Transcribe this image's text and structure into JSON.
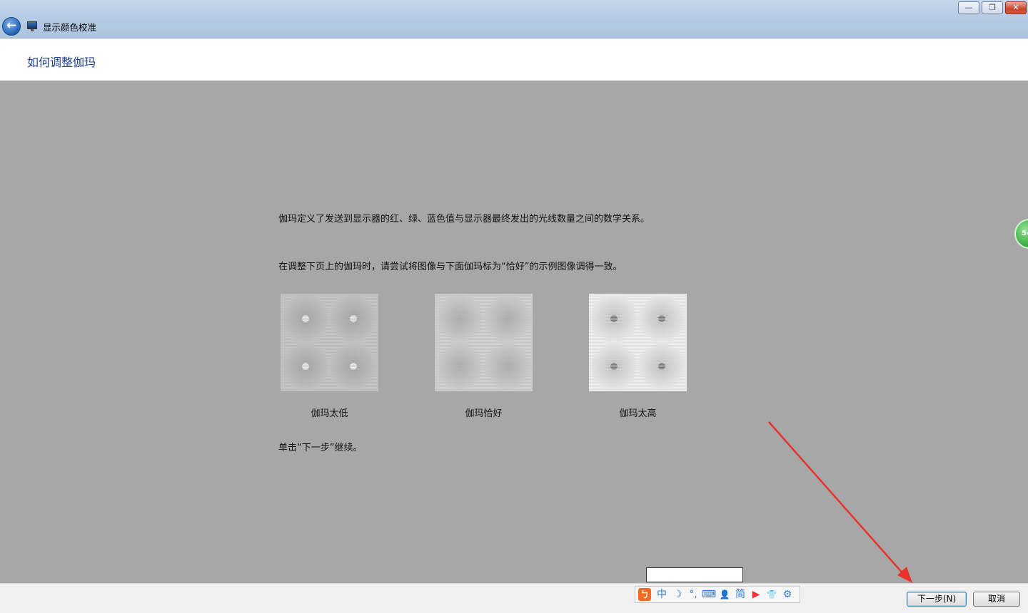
{
  "window": {
    "title": "显示颜色校准",
    "controls": {
      "minimize": "—",
      "maximize": "❐",
      "close": "✕"
    }
  },
  "header": {
    "page_title": "如何调整伽玛"
  },
  "content": {
    "paragraph1": "伽玛定义了发送到显示器的红、绿、蓝色值与显示器最终发出的光线数量之间的数学关系。",
    "paragraph2": "在调整下页上的伽玛时，请尝试将图像与下面伽玛标为“恰好”的示例图像调得一致。",
    "samples": [
      {
        "caption": "伽玛太低",
        "dot": "light"
      },
      {
        "caption": "伽玛恰好",
        "dot": "none"
      },
      {
        "caption": "伽玛太高",
        "dot": "dark"
      }
    ],
    "paragraph3": "单击“下一步”继续。"
  },
  "side_badge": {
    "text": "54"
  },
  "footer": {
    "next_label": "下一步(N)",
    "cancel_label": "取消"
  },
  "ime_toolbar": {
    "items": [
      {
        "icon": "ime-logo-icon",
        "glyph": "ㄅ"
      },
      {
        "icon": "chinese-mode-icon",
        "glyph": "中"
      },
      {
        "icon": "moon-icon",
        "glyph": "☽"
      },
      {
        "icon": "punctuation-icon",
        "glyph": "°,"
      },
      {
        "icon": "keyboard-icon",
        "glyph": "⌨"
      },
      {
        "icon": "user-icon",
        "glyph": "👤"
      },
      {
        "icon": "simplified-icon",
        "glyph": "简"
      },
      {
        "icon": "video-icon",
        "glyph": "▶"
      },
      {
        "icon": "skin-icon",
        "glyph": "👕"
      },
      {
        "icon": "settings-icon",
        "glyph": "⚙"
      }
    ]
  },
  "colors": {
    "titlebar": "#b3cae3",
    "content_bg": "#a7a7a7",
    "page_title": "#1e3f8f",
    "arrow": "#e8322b"
  }
}
